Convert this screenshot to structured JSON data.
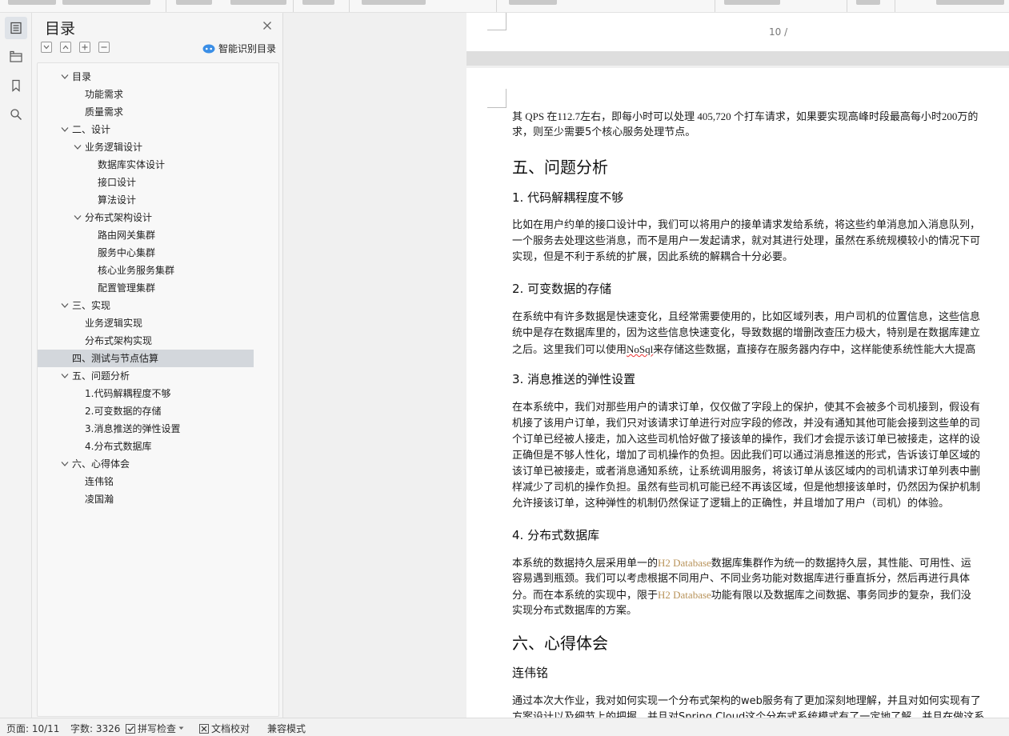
{
  "toc_panel": {
    "title": "目录",
    "smart_toc_label": "智能识别目录",
    "items": [
      {
        "label": "目录",
        "level": 1,
        "expandable": true
      },
      {
        "label": "功能需求",
        "level": 2,
        "expandable": false
      },
      {
        "label": "质量需求",
        "level": 2,
        "expandable": false
      },
      {
        "label": "二、设计",
        "level": 1,
        "expandable": true
      },
      {
        "label": "业务逻辑设计",
        "level": 2,
        "expandable": true
      },
      {
        "label": "数据库实体设计",
        "level": 3,
        "expandable": false
      },
      {
        "label": "接口设计",
        "level": 3,
        "expandable": false
      },
      {
        "label": "算法设计",
        "level": 3,
        "expandable": false
      },
      {
        "label": "分布式架构设计",
        "level": 2,
        "expandable": true
      },
      {
        "label": "路由网关集群",
        "level": 3,
        "expandable": false
      },
      {
        "label": "服务中心集群",
        "level": 3,
        "expandable": false
      },
      {
        "label": "核心业务服务集群",
        "level": 3,
        "expandable": false
      },
      {
        "label": "配置管理集群",
        "level": 3,
        "expandable": false
      },
      {
        "label": "三、实现",
        "level": 1,
        "expandable": true
      },
      {
        "label": "业务逻辑实现",
        "level": 2,
        "expandable": false
      },
      {
        "label": "分布式架构实现",
        "level": 2,
        "expandable": false
      },
      {
        "label": "四、测试与节点估算",
        "level": 1,
        "expandable": false,
        "selected": true
      },
      {
        "label": "五、问题分析",
        "level": 1,
        "expandable": true
      },
      {
        "label": "1.代码解耦程度不够",
        "level": 2,
        "expandable": false
      },
      {
        "label": "2.可变数据的存储",
        "level": 2,
        "expandable": false
      },
      {
        "label": "3.消息推送的弹性设置",
        "level": 2,
        "expandable": false
      },
      {
        "label": "4.分布式数据库",
        "level": 2,
        "expandable": false
      },
      {
        "label": "六、心得体会",
        "level": 1,
        "expandable": true
      },
      {
        "label": "连伟铭",
        "level": 2,
        "expandable": false
      },
      {
        "label": "凌国瀚",
        "level": 2,
        "expandable": false
      }
    ]
  },
  "document": {
    "page_number_header": "10 /",
    "lines": [
      {
        "kind": "body",
        "text": "其 QPS 在112.7左右，即每小时可以处理 405,720 个打车请求，如果要实现高峰时段最高每小时200万的",
        "serif": true
      },
      {
        "kind": "body",
        "text": "求，则至少需要5个核心服务处理节点。"
      },
      {
        "kind": "h1",
        "text": "五、问题分析"
      },
      {
        "kind": "h2",
        "text": "1. 代码解耦程度不够"
      },
      {
        "kind": "body",
        "text": "比如在用户约单的接口设计中，我们可以将用户的接单请求发给系统，将这些约单消息加入消息队列，"
      },
      {
        "kind": "body",
        "text": "一个服务去处理这些消息，而不是用户一发起请求，就对其进行处理，虽然在系统规模较小的情况下可"
      },
      {
        "kind": "body",
        "text": "实现，但是不利于系统的扩展，因此系统的解耦合十分必要。"
      },
      {
        "kind": "h2",
        "text": "2. 可变数据的存储"
      },
      {
        "kind": "body",
        "text": "在系统中有许多数据是快速变化，且经常需要使用的，比如区域列表，用户司机的位置信息，这些信息"
      },
      {
        "kind": "body",
        "text": "统中是存在数据库里的，因为这些信息快速变化，导致数据的增删改查压力极大，特别是在数据库建立"
      },
      {
        "kind": "body_nosql",
        "before": "之后。这里我们可以使用",
        "term": "NoSql",
        "after": "来存储这些数据，直接存在服务器内存中，这样能使系统性能大大提高"
      },
      {
        "kind": "h2",
        "text": "3. 消息推送的弹性设置"
      },
      {
        "kind": "body",
        "text": "在本系统中，我们对那些用户的请求订单，仅仅做了字段上的保护，使其不会被多个司机接到，假设有"
      },
      {
        "kind": "body",
        "text": "机接了该用户订单，我们只对该请求订单进行对应字段的修改，并没有通知其他可能会接到这些单的司"
      },
      {
        "kind": "body",
        "text": "个订单已经被人接走，加入这些司机恰好做了接该单的操作，我们才会提示该订单已被接走，这样的设"
      },
      {
        "kind": "body",
        "text": "正确但是不够人性化，增加了司机操作的负担。因此我们可以通过消息推送的形式，告诉该订单区域的"
      },
      {
        "kind": "body",
        "text": "该订单已被接走，或者消息通知系统，让系统调用服务，将该订单从该区域内的司机请求订单列表中删"
      },
      {
        "kind": "body",
        "text": "样减少了司机的操作负担。虽然有些司机可能已经不再该区域，但是他想接该单时，仍然因为保护机制"
      },
      {
        "kind": "body",
        "text": "允许接该订单，这种弹性的机制仍然保证了逻辑上的正确性，并且增加了用户（司机）的体验。"
      },
      {
        "kind": "h2",
        "text": "4. 分布式数据库"
      },
      {
        "kind": "body_h2db",
        "before": "本系统的数据持久层采用单一的",
        "term": "H2 Database",
        "after": "数据库集群作为统一的数据持久层，其性能、可用性、运"
      },
      {
        "kind": "body",
        "text": "容易遇到瓶颈。我们可以考虑根据不同用户、不同业务功能对数据库进行垂直拆分，然后再进行具体"
      },
      {
        "kind": "body_h2db",
        "before": "分。而在本系统的实现中，限于",
        "term": "H2 Database",
        "after": "功能有限以及数据库之间数据、事务同步的复杂，我们没"
      },
      {
        "kind": "body",
        "text": "实现分布式数据库的方案。"
      },
      {
        "kind": "h1",
        "text": "六、心得体会"
      },
      {
        "kind": "h2",
        "text": "连伟铭"
      },
      {
        "kind": "body",
        "text": "通过本次大作业，我对如何实现一个分布式架构的web服务有了更加深刻地理解，并且对如何实现有了"
      },
      {
        "kind": "body",
        "text": "方案设计以及细节上的把握，并且对Spring Cloud这个分布式系统模式有了一定地了解，并且在做这系"
      }
    ]
  },
  "status_bar": {
    "page": "页面: 10/11",
    "word_count": "字数: 3326",
    "spell_check": "拼写检查",
    "doc_proof": "文档校对",
    "compat_mode": "兼容模式"
  },
  "colors": {
    "selected_row": "#d3d7dc",
    "highlight_term": "#b8935a",
    "smart_icon": "#3a8ee6"
  }
}
